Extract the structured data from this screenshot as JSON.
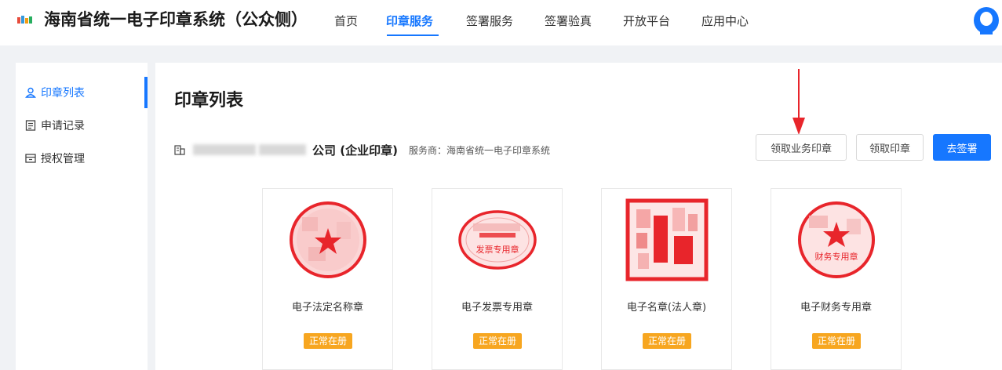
{
  "header": {
    "app_title": "海南省统一电子印章系统（公众侧）",
    "nav": [
      "首页",
      "印章服务",
      "签署服务",
      "签署验真",
      "开放平台",
      "应用中心"
    ],
    "active_nav": "印章服务",
    "accent_color": "#1677ff"
  },
  "sidebar": {
    "items": [
      {
        "label": "印章列表",
        "icon": "user-icon",
        "active": true
      },
      {
        "label": "申请记录",
        "icon": "document-list-icon",
        "active": false
      },
      {
        "label": "授权管理",
        "icon": "authorization-icon",
        "active": false
      }
    ]
  },
  "main": {
    "title": "印章列表",
    "company_suffix": "公司 (企业印章)",
    "provider": "服务商：海南省统一电子印章系统",
    "buttons": {
      "get_business_seal": "领取业务印章",
      "get_seal": "领取印章",
      "go_sign": "去签署"
    },
    "seals": [
      {
        "name": "电子法定名称章",
        "status": "正常在册",
        "seal_text": ""
      },
      {
        "name": "电子发票专用章",
        "status": "正常在册",
        "seal_text": "发票专用章"
      },
      {
        "name": "电子名章(法人章)",
        "status": "正常在册",
        "seal_text": ""
      },
      {
        "name": "电子财务专用章",
        "status": "正常在册",
        "seal_text": "财务专用章"
      }
    ],
    "status_color": "#f7a620",
    "seal_color": "#e8252b"
  }
}
